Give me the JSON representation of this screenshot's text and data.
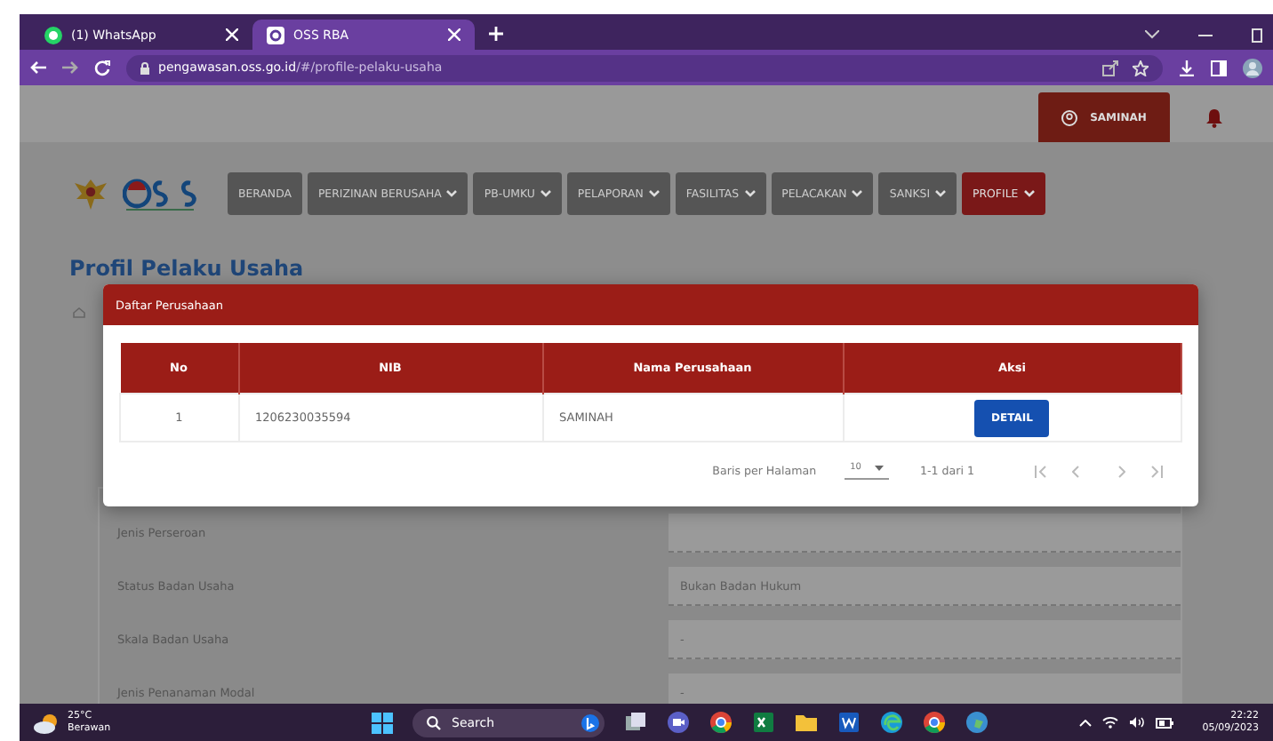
{
  "browser": {
    "tabs": [
      {
        "title": "(1) WhatsApp",
        "selected": false
      },
      {
        "title": "OSS RBA",
        "selected": true
      }
    ],
    "url_host": "pengawasan.oss.go.id",
    "url_path": "/#/profile-pelaku-usaha"
  },
  "header": {
    "user": "SAMINAH"
  },
  "nav": [
    {
      "label": "BERANDA",
      "dropdown": false,
      "selected": false
    },
    {
      "label": "PERIZINAN BERUSAHA",
      "dropdown": true,
      "selected": false
    },
    {
      "label": "PB-UMKU",
      "dropdown": true,
      "selected": false
    },
    {
      "label": "PELAPORAN",
      "dropdown": true,
      "selected": false
    },
    {
      "label": "FASILITAS",
      "dropdown": true,
      "selected": false
    },
    {
      "label": "PELACAKAN",
      "dropdown": true,
      "selected": false
    },
    {
      "label": "SANKSI",
      "dropdown": true,
      "selected": false
    },
    {
      "label": "PROFILE",
      "dropdown": true,
      "selected": true
    }
  ],
  "page_title": "Profil Pelaku Usaha",
  "form": [
    {
      "label": "Jenis Perseroan"
    },
    {
      "label": "Status Badan Usaha",
      "value": "Bukan Badan Hukum"
    },
    {
      "label": "Skala Badan Usaha",
      "value": "-"
    },
    {
      "label": "Jenis Penanaman Modal",
      "value": "-"
    }
  ],
  "dialog": {
    "title": "Daftar Perusahaan",
    "table": {
      "columns": [
        "No",
        "NIB",
        "Nama Perusahaan",
        "Aksi"
      ],
      "rows": [
        {
          "no": "1",
          "nib": "1206230035594",
          "name": "SAMINAH",
          "action": "DETAIL"
        }
      ]
    },
    "pagination": {
      "rows_label": "Baris per Halaman",
      "rows_per_page": "10",
      "range": "1-1 dari 1"
    }
  },
  "taskbar": {
    "temperature": "25°C",
    "weather": "Berawan",
    "search": "Search",
    "time": "22:22",
    "date": "05/09/2023"
  }
}
